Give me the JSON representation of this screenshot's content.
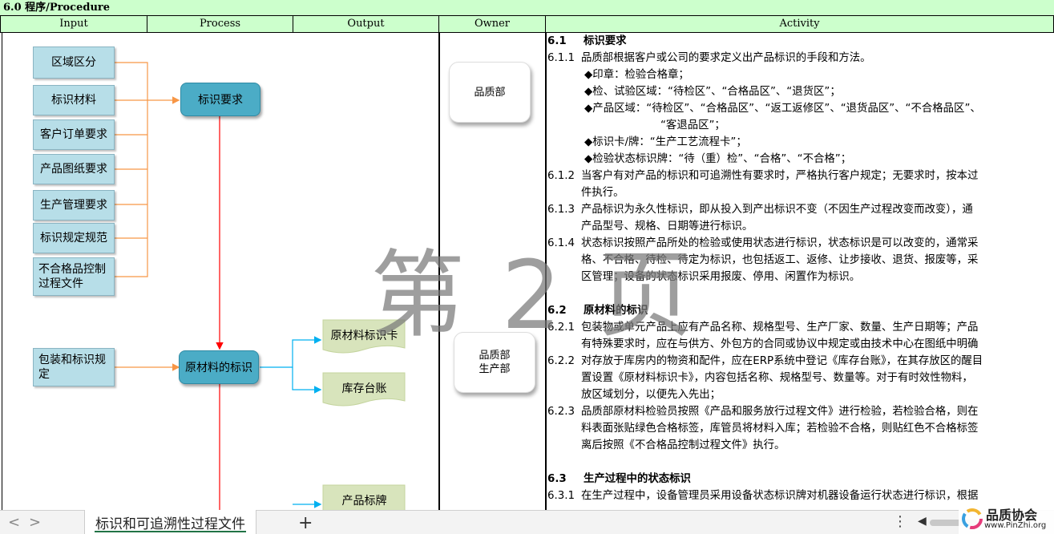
{
  "section_title": "6.0  程序/Procedure",
  "columns": [
    "Input",
    "Process",
    "Output",
    "Owner",
    "Activity"
  ],
  "inputs": [
    "区域区分",
    "标识材料",
    "客户订单要求",
    "产品图纸要求",
    "生产管理要求",
    "标识规定规范",
    "不合格品控制过程文件",
    "包装和标识规定"
  ],
  "process_steps": [
    "标识要求",
    "原材料的标识"
  ],
  "outputs": [
    "原材料标识卡",
    "库存台账",
    "产品标牌"
  ],
  "owners": [
    "品质部",
    "品质部\n生产部"
  ],
  "activity": [
    {
      "num": "6.1",
      "text": "标识要求",
      "bold": true
    },
    {
      "num": "6.1.1",
      "text": "品质部根据客户或公司的要求定义出产品标识的手段和方法。"
    },
    {
      "num": "",
      "text": "◆印章：检验合格章；",
      "indent": 1
    },
    {
      "num": "",
      "text": "◆检、试验区域：“待检区”、“合格品区”、“退货区”；",
      "indent": 1
    },
    {
      "num": "",
      "text": "◆产品区域：“待检区”、“合格品区”、“返工返修区”、“退货品区”、“不合格品区”、",
      "indent": 1
    },
    {
      "num": "",
      "text": "“客退品区”；",
      "indent": 2
    },
    {
      "num": "",
      "text": "◆标识卡/牌：“生产工艺流程卡”；",
      "indent": 1
    },
    {
      "num": "",
      "text": "◆检验状态标识牌：“待（重）检”、“合格”、“不合格”；",
      "indent": 1
    },
    {
      "num": "6.1.2",
      "text": "当客户有对产品的标识和可追溯性有要求时，严格执行客户规定；无要求时，按本过"
    },
    {
      "num": "",
      "text": "件执行。",
      "indent": 0
    },
    {
      "num": "6.1.3",
      "text": "产品标识为永久性标识，即从投入到产出标识不变（不因生产过程改变而改变），通"
    },
    {
      "num": "",
      "text": "产品型号、规格、日期等进行标识。",
      "indent": 0
    },
    {
      "num": "6.1.4",
      "text": "状态标识按照产品所处的检验或使用状态进行标识，状态标识是可以改变的，通常采"
    },
    {
      "num": "",
      "text": "格、不合格、待检、待定为标识，也包括返工、返修、让步接收、退货、报废等，采"
    },
    {
      "num": "",
      "text": "区管理；设备的状态标识采用报废、停用、闲置作为标识。"
    },
    {
      "num": "",
      "text": ""
    },
    {
      "num": "6.2",
      "text": "原材料的标识",
      "bold": true
    },
    {
      "num": "6.2.1",
      "text": "包装物或单元产品上应有产品名称、规格型号、生产厂家、数量、生产日期等；产品"
    },
    {
      "num": "",
      "text": "有特殊要求时，应在与供方、外包方的合同或协议中规定或由技术中心在图纸中明确"
    },
    {
      "num": "6.2.2",
      "text": "对存放于库房内的物资和配件，应在ERP系统中登记《库存台账》，在其存放区的醒目"
    },
    {
      "num": "",
      "text": "置设置《原材料标识卡》，内容包括名称、规格型号、数量等。对于有时效性物料，"
    },
    {
      "num": "",
      "text": "放区域划分，以便先入先出；"
    },
    {
      "num": "6.2.3",
      "text": "品质部原材料检验员按照《产品和服务放行过程文件》进行检验，若检验合格，则在"
    },
    {
      "num": "",
      "text": "料表面张贴绿色合格标签，库管员将材料入库；若检验不合格，则贴红色不合格标签"
    },
    {
      "num": "",
      "text": "离后按照《不合格品控制过程文件》执行。"
    },
    {
      "num": "",
      "text": ""
    },
    {
      "num": "6.3",
      "text": "生产过程中的状态标识",
      "bold": true
    },
    {
      "num": "6.3.1",
      "text": "在生产过程中，设备管理员采用设备状态标识牌对机器设备运行状态进行标识，根据"
    }
  ],
  "watermark": "第 2 页",
  "sheet_tab": "标识和可追溯性过程文件",
  "add_sheet_symbol": "+",
  "nav_prev": "<",
  "nav_next": ">",
  "menu_symbol": "⋮",
  "logo": {
    "name": "品质协会",
    "url": "www.PinZhi.org"
  },
  "colors": {
    "header_bg": "#ccffcc",
    "input_box": "#b7dee8",
    "process_box": "#4bacc6",
    "output_doc": "#d8e4bc",
    "flow_arrow": "#ff0000",
    "input_line": "#f79646",
    "output_line": "#00b0f0"
  }
}
